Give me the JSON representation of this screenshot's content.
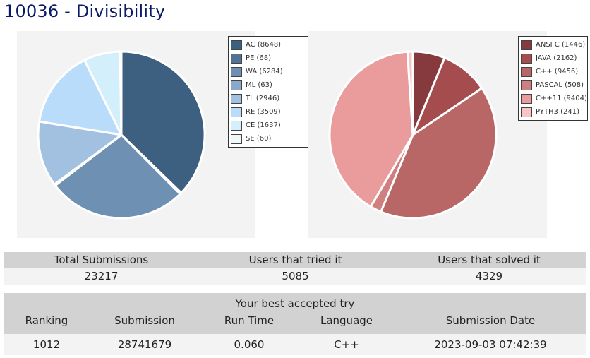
{
  "page": {
    "title": "10036 - Divisibility"
  },
  "chart_data": [
    {
      "type": "pie",
      "title": "",
      "legend_position": "top-right",
      "categories": [
        "AC",
        "PE",
        "WA",
        "ML",
        "TL",
        "RE",
        "CE",
        "SE"
      ],
      "values": [
        8648,
        68,
        6284,
        63,
        2946,
        3509,
        1637,
        60
      ],
      "legend_labels": [
        "AC (8648)",
        "PE (68)",
        "WA (6284)",
        "ML (63)",
        "TL (2946)",
        "RE (3509)",
        "CE (1637)",
        "SE (60)"
      ],
      "colors": [
        "#3d5f80",
        "#4f7295",
        "#6e90b3",
        "#8aa8c9",
        "#a2c0e0",
        "#badcfb",
        "#d4effc",
        "#eef8f8"
      ]
    },
    {
      "type": "pie",
      "title": "",
      "legend_position": "top-right",
      "categories": [
        "ANSI C",
        "JAVA",
        "C++",
        "PASCAL",
        "C++11",
        "PYTH3"
      ],
      "values": [
        1446,
        2162,
        9456,
        508,
        9404,
        241
      ],
      "legend_labels": [
        "ANSI C (1446)",
        "JAVA (2162)",
        "C++ (9456)",
        "PASCAL (508)",
        "C++11 (9404)",
        "PYTH3 (241)"
      ],
      "colors": [
        "#873a3d",
        "#a54c4e",
        "#b96667",
        "#d07f80",
        "#ea9b9c",
        "#f8c4c4"
      ]
    }
  ],
  "totals": {
    "headers": [
      "Total Submissions",
      "Users that tried it",
      "Users that solved it"
    ],
    "values": [
      "23217",
      "5085",
      "4329"
    ]
  },
  "best_try": {
    "caption": "Your best accepted try",
    "headers": [
      "Ranking",
      "Submission",
      "Run Time",
      "Language",
      "Submission Date"
    ],
    "values": [
      "1012",
      "28741679",
      "0.060",
      "C++",
      "2023-09-03 07:42:39"
    ]
  }
}
